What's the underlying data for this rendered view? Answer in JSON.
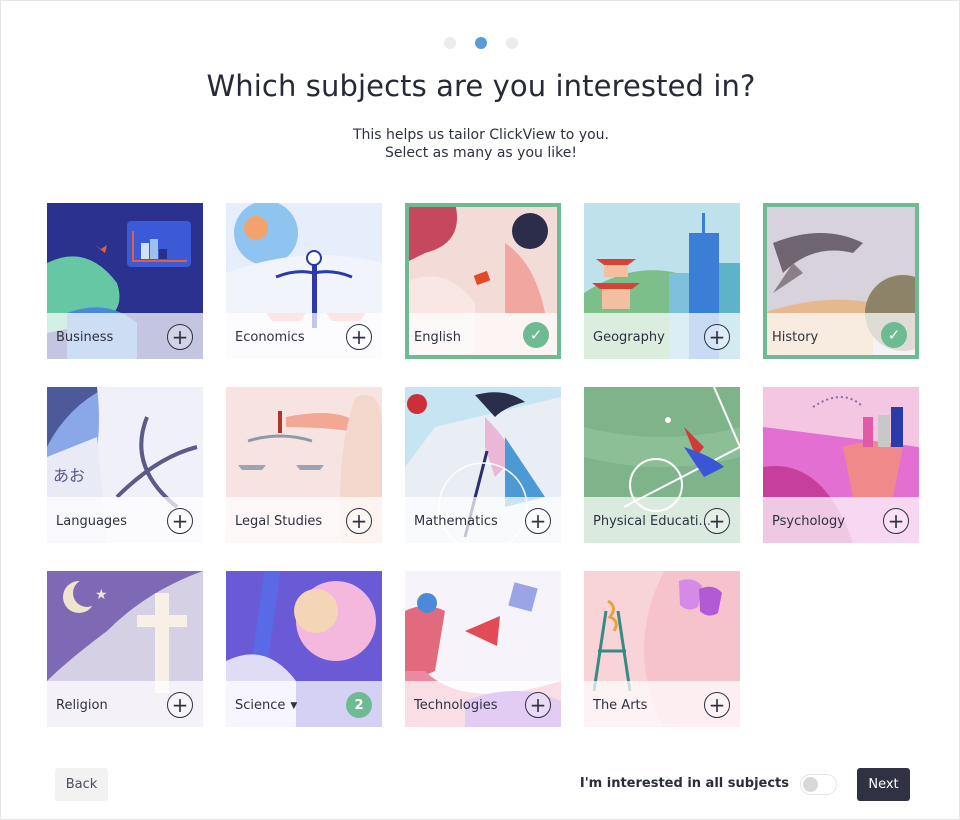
{
  "stepper": {
    "total_steps": 3,
    "current_step": 2
  },
  "header": {
    "title": "Which subjects are you interested in?",
    "subtitle_line1": "This helps us tailor ClickView to you.",
    "subtitle_line2": "Select as many as you like!"
  },
  "colors": {
    "selected_accent": "#6dba93",
    "active_dot": "#5b9bd5",
    "primary_button": "#2f3242"
  },
  "subjects": [
    {
      "label": "Business",
      "state": "unselected",
      "action_icon": "plus-icon"
    },
    {
      "label": "Economics",
      "state": "unselected",
      "action_icon": "plus-icon"
    },
    {
      "label": "English",
      "state": "selected",
      "action_icon": "check-icon"
    },
    {
      "label": "Geography",
      "state": "unselected",
      "action_icon": "plus-icon"
    },
    {
      "label": "History",
      "state": "selected",
      "action_icon": "check-icon"
    },
    {
      "label": "Languages",
      "state": "unselected",
      "action_icon": "plus-icon"
    },
    {
      "label": "Legal Studies",
      "state": "unselected",
      "action_icon": "plus-icon"
    },
    {
      "label": "Mathematics",
      "state": "unselected",
      "action_icon": "plus-icon"
    },
    {
      "label": "Physical Educati...",
      "state": "unselected",
      "action_icon": "plus-icon"
    },
    {
      "label": "Psychology",
      "state": "unselected",
      "action_icon": "plus-icon"
    },
    {
      "label": "Religion",
      "state": "unselected",
      "action_icon": "plus-icon"
    },
    {
      "label": "Science",
      "state": "partial",
      "has_dropdown": true,
      "selected_count": "2"
    },
    {
      "label": "Technologies",
      "state": "unselected",
      "action_icon": "plus-icon"
    },
    {
      "label": "The Arts",
      "state": "unselected",
      "action_icon": "plus-icon"
    }
  ],
  "footer": {
    "back_label": "Back",
    "all_subjects_label": "I'm interested in all subjects",
    "all_subjects_toggle": false,
    "next_label": "Next"
  },
  "glyphs": {
    "plus": "+",
    "check": "✓",
    "caret": "▼"
  }
}
